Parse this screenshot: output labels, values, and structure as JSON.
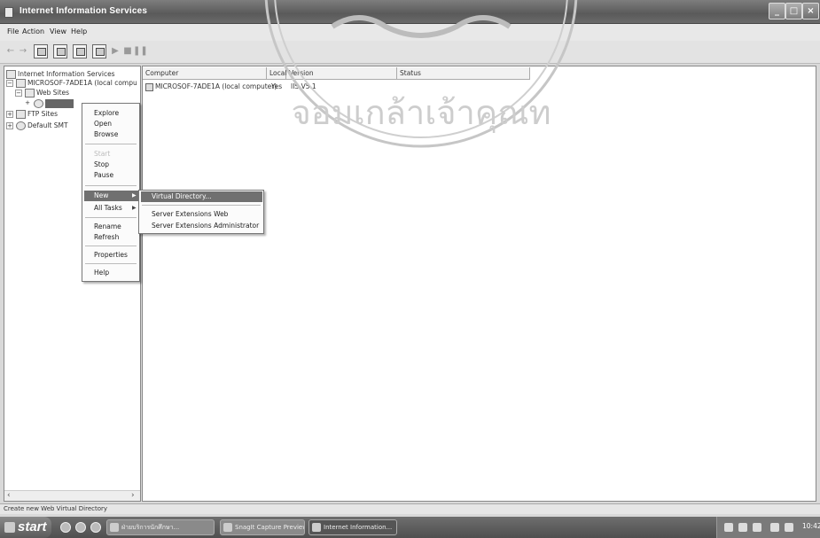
{
  "window": {
    "title": "Internet Information Services"
  },
  "menubar": [
    "File",
    "Action",
    "View",
    "Help"
  ],
  "tree": {
    "root": "Internet Information Services",
    "computer": "MICROSOF-7ADE1A (local compu",
    "web_sites": "Web Sites",
    "ftp_sites": "FTP Sites",
    "smtp": "Default SMT"
  },
  "list": {
    "columns": [
      "Computer",
      "Local",
      "Version",
      "Status"
    ],
    "row": {
      "computer": "MICROSOF-7ADE1A (local computer)",
      "local": "Yes",
      "version": "IIS V5.1",
      "status": ""
    }
  },
  "context_menu": {
    "items": [
      "Explore",
      "Open",
      "Browse",
      "Start",
      "Stop",
      "Pause",
      "New",
      "All Tasks",
      "Rename",
      "Refresh",
      "Properties",
      "Help"
    ]
  },
  "submenu": {
    "items": [
      "Virtual Directory...",
      "Server Extensions Web",
      "Server Extensions Administrator"
    ]
  },
  "statusbar": {
    "text": "Create new Web Virtual Directory"
  },
  "taskbar": {
    "start": "start",
    "buttons": [
      "ฝ่ายบริการนักศึกษา...",
      "SnagIt Capture Preview",
      "Internet Information..."
    ],
    "clock": "10:42"
  },
  "watermark": {
    "text": "จอมเกล้าเจ้าคุณท"
  }
}
